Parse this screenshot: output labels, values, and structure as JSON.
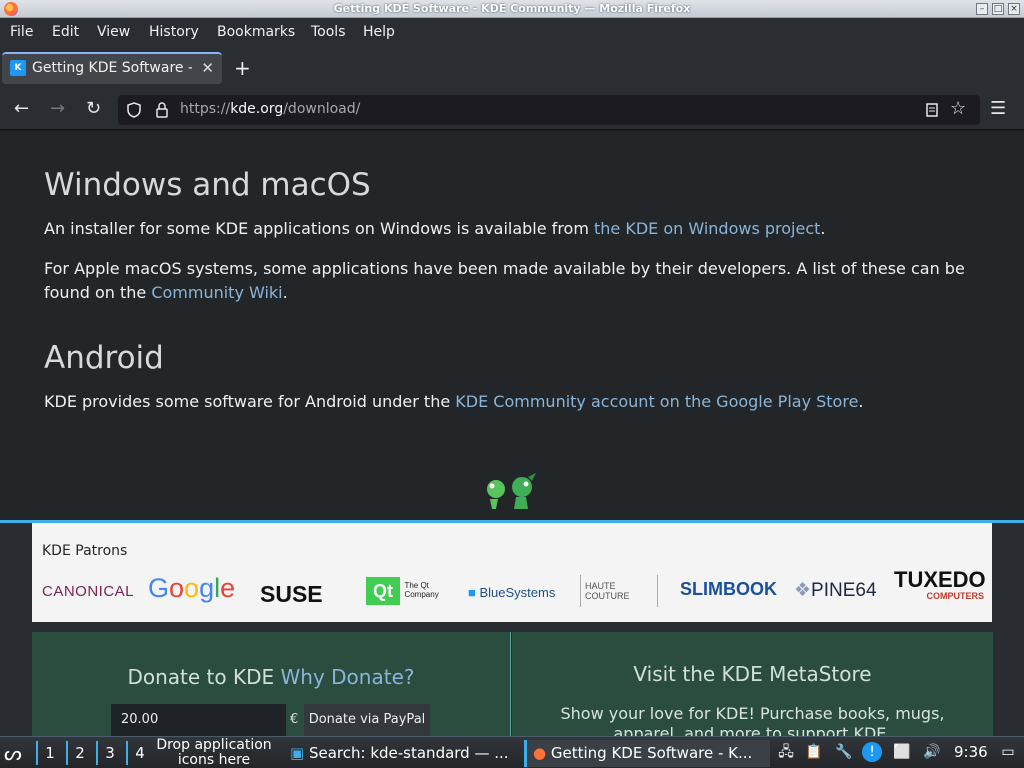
{
  "window": {
    "title": "Getting KDE Software - KDE Community — Mozilla Firefox"
  },
  "menubar": {
    "items": [
      "File",
      "Edit",
      "View",
      "History",
      "Bookmarks",
      "Tools",
      "Help"
    ]
  },
  "tab": {
    "title": "Getting KDE Software - K"
  },
  "navbar": {
    "url_scheme": "https://",
    "url_host": "kde.org",
    "url_path": "/download/"
  },
  "content": {
    "section1_heading": "Windows and macOS",
    "section1_p1_text": "An installer for some KDE applications on Windows is available from ",
    "section1_p1_link": "the KDE on Windows project",
    "section1_p1_end": ".",
    "section1_p2_text": "For Apple macOS systems, some applications have been made available by their developers. A list of these can be found on the ",
    "section1_p2_link": "Community Wiki",
    "section1_p2_end": ".",
    "section2_heading": "Android",
    "section2_p_text": "KDE provides some software for Android under the ",
    "section2_p_link": "KDE Community account on the Google Play Store",
    "section2_p_end": "."
  },
  "patrons": {
    "title": "KDE Patrons",
    "logos": [
      "CANONICAL",
      "Google",
      "SUSE",
      "The Qt Company",
      "BlueSystems",
      "HAUTE COUTURE",
      "SLIMBOOK",
      "PINE64",
      "TUXEDO COMPUTERS"
    ]
  },
  "donate": {
    "title_prefix": "Donate to KDE ",
    "title_link": "Why Donate?",
    "amount": "20.00",
    "currency": "€",
    "button": "Donate via PayPal"
  },
  "metastore": {
    "title": "Visit the KDE MetaStore",
    "desc": "Show your love for KDE! Purchase books, mugs, apparel, and more to support KDE."
  },
  "taskbar": {
    "desktops": [
      "1",
      "2",
      "3",
      "4"
    ],
    "drop_text": "Drop application icons here",
    "task1": "Search: kde-standard — ...",
    "task2": "Getting KDE Software - K...",
    "clock": "9:36"
  },
  "colors": {
    "accent": "#3daee9",
    "link": "#8ab4d8",
    "page_bg": "#232629",
    "donate_bg": "#2a4d3f"
  }
}
